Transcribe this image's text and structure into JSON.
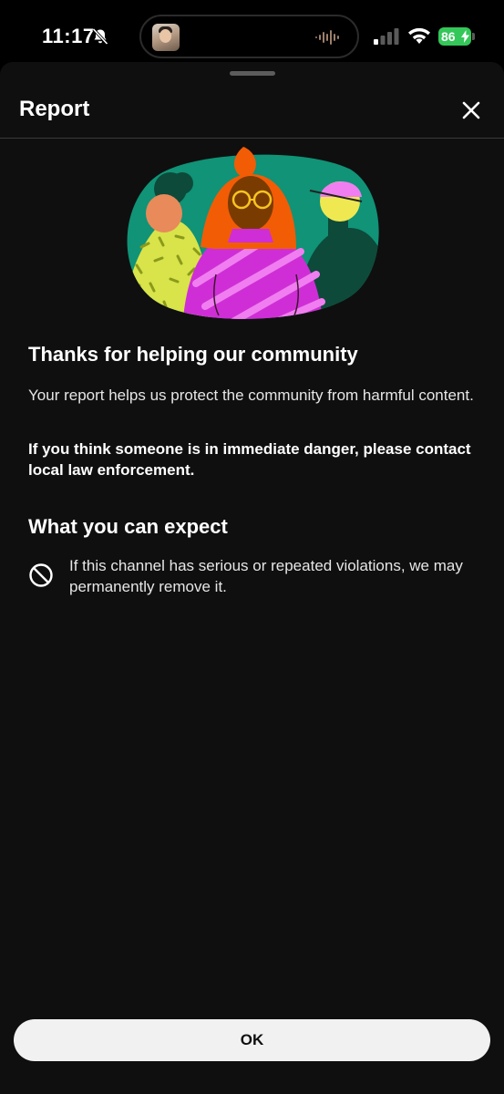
{
  "status_bar": {
    "time": "11:17",
    "battery": "86"
  },
  "sheet": {
    "title": "Report"
  },
  "content": {
    "heading": "Thanks for helping our community",
    "body": "Your report helps us protect the community from harmful content.",
    "body_bold": "If you think someone is in immediate danger, please contact local law enforcement.",
    "subheading": "What you can expect",
    "expectation": "If this channel has serious or repeated violations, we may permanently remove it."
  },
  "footer": {
    "ok_label": "OK"
  },
  "icons": {
    "bell": "bell-slash-icon",
    "close": "close-icon",
    "block": "block-icon",
    "signal": "cellular-signal-icon",
    "wifi": "wifi-icon",
    "battery": "battery-icon",
    "waveform": "audio-waveform-icon"
  },
  "colors": {
    "sheet_background": "#0f0f0f",
    "button_background": "#f1f1f1",
    "battery_green": "#34c759",
    "illustration_teal": "#109377",
    "illustration_magenta": "#cf2ed6",
    "illustration_orange": "#f25c05"
  }
}
